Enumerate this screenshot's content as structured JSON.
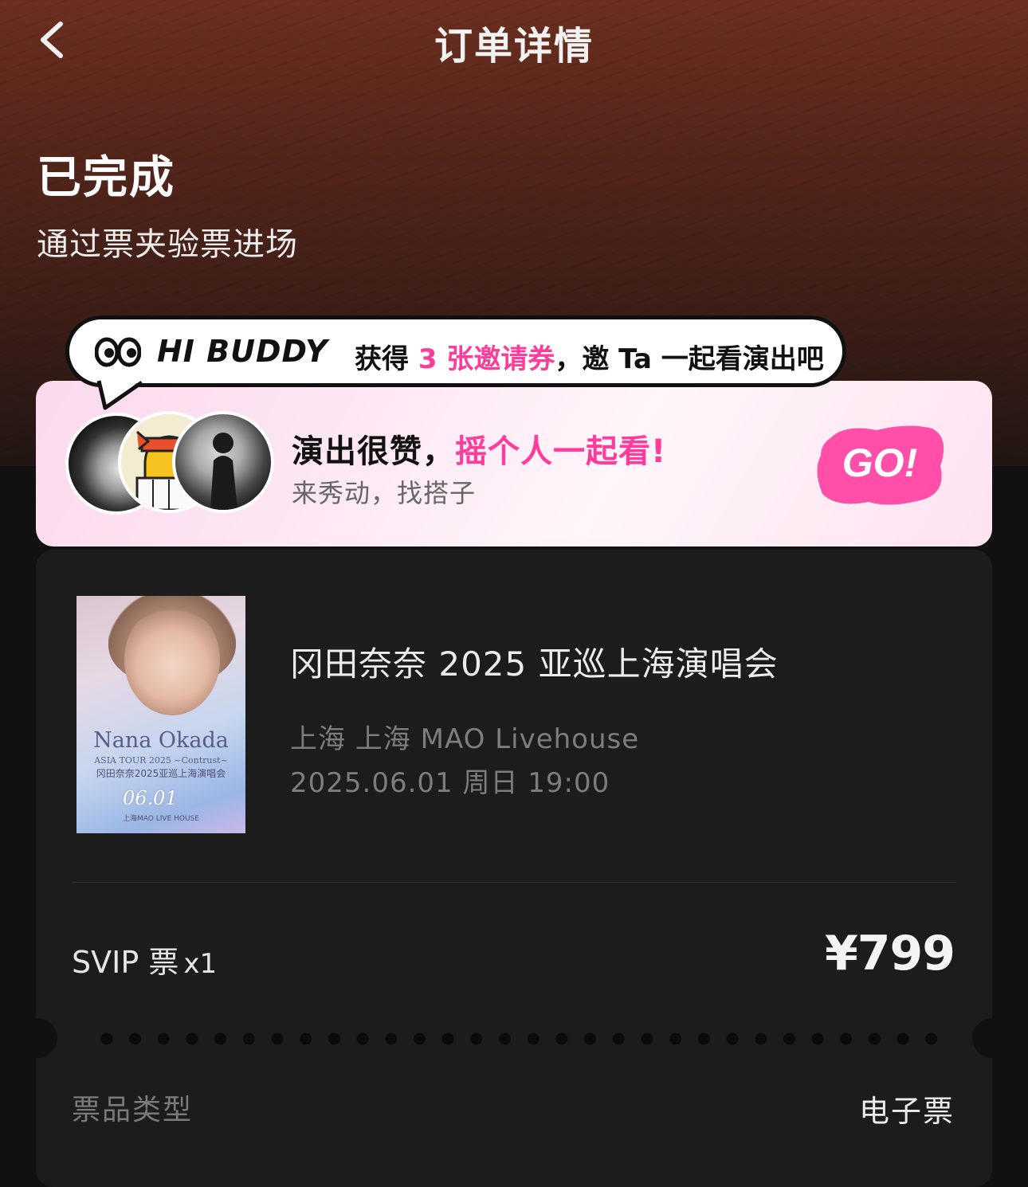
{
  "header": {
    "title": "订单详情",
    "back_icon": "chevron-left-icon"
  },
  "status": {
    "title": "已完成",
    "subtitle": "通过票夹验票进场"
  },
  "buddy_bubble": {
    "brand": "HI BUDDY",
    "text_prefix": "获得 ",
    "highlight": "3 张邀请券",
    "text_suffix": "，邀 Ta 一起看演出吧",
    "highlight_color": "#ff3c9b"
  },
  "buddy_card": {
    "title_prefix": "演出很赞，",
    "title_highlight": "摇个人一起看!",
    "subtitle": "来秀动，找搭子",
    "go_label": "GO!",
    "go_color": "#ff4fa8"
  },
  "order": {
    "poster": {
      "name": "Nana Okada",
      "line1": "ASIA TOUR 2025 ~Contrust~",
      "line2": "冈田奈奈2025亚巡上海演唱会",
      "date": "06.01",
      "line3": "上海MAO LIVE HOUSE"
    },
    "show_title": "冈田奈奈 2025 亚巡上海演唱会",
    "venue": "上海 上海 MAO Livehouse",
    "datetime": "2025.06.01 周日 19:00",
    "ticket_name": "SVIP 票",
    "ticket_qty": "x1",
    "price": "¥799",
    "ticket_type_label": "票品类型",
    "ticket_type_value": "电子票"
  }
}
